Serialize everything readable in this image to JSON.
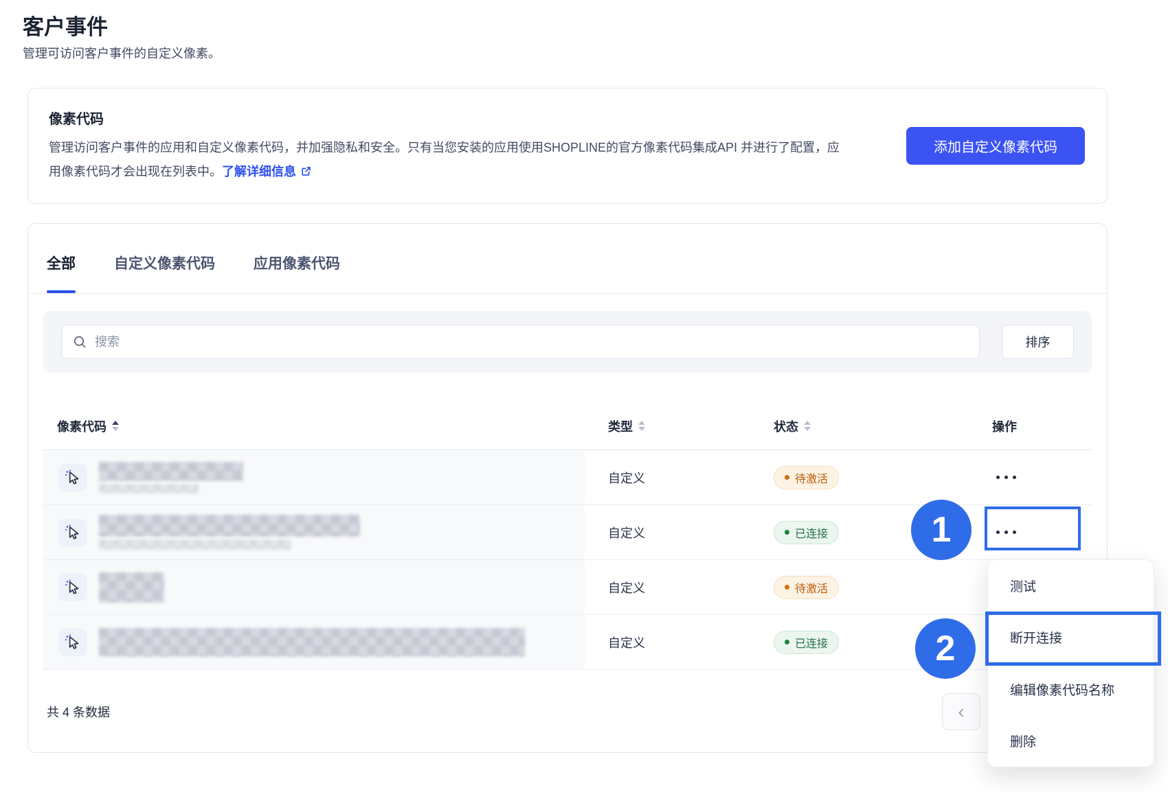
{
  "page": {
    "title": "客户事件",
    "subtitle": "管理可访问客户事件的自定义像素。"
  },
  "pixel_card": {
    "title": "像素代码",
    "description_line1": "管理访问客户事件的应用和自定义像素代码，并加强隐私和安全。只有当您安装的应用使用SHOPLINE的官方像素代码集成API",
    "description_line2": "并进行了配置，应用像素代码才会出现在列表中。",
    "link_label": "了解详细信息",
    "add_button_label": "添加自定义像素代码"
  },
  "table_card": {
    "tabs": [
      {
        "label": "全部",
        "active": true
      },
      {
        "label": "自定义像素代码",
        "active": false
      },
      {
        "label": "应用像素代码",
        "active": false
      }
    ],
    "search_placeholder": "搜索",
    "sort_button_label": "排序",
    "columns": [
      "像素代码",
      "类型",
      "状态",
      "操作"
    ],
    "rows": [
      {
        "type": "自定义",
        "status": "待激活",
        "status_kind": "pending"
      },
      {
        "type": "自定义",
        "status": "已连接",
        "status_kind": "connected"
      },
      {
        "type": "自定义",
        "status": "待激活",
        "status_kind": "pending"
      },
      {
        "type": "自定义",
        "status": "已连接",
        "status_kind": "connected"
      }
    ],
    "footer_total": "共 4 条数据",
    "pagination_prev": "‹"
  },
  "action_menu": {
    "items": [
      "测试",
      "断开连接",
      "编辑像素代码名称",
      "删除"
    ],
    "highlighted_item": "断开连接"
  },
  "annotations": {
    "step1": "1",
    "step2": "2"
  },
  "colors": {
    "accent_blue": "#3c53f3",
    "link_blue": "#2e51ee",
    "tab_underline": "#2b50e8",
    "annotation_blue": "#2e6ce8",
    "status_pending_text": "#b95d08",
    "status_pending_bg": "#fdf3e5",
    "status_connected_text": "#27724a",
    "status_connected_bg": "#ebf6ef"
  }
}
